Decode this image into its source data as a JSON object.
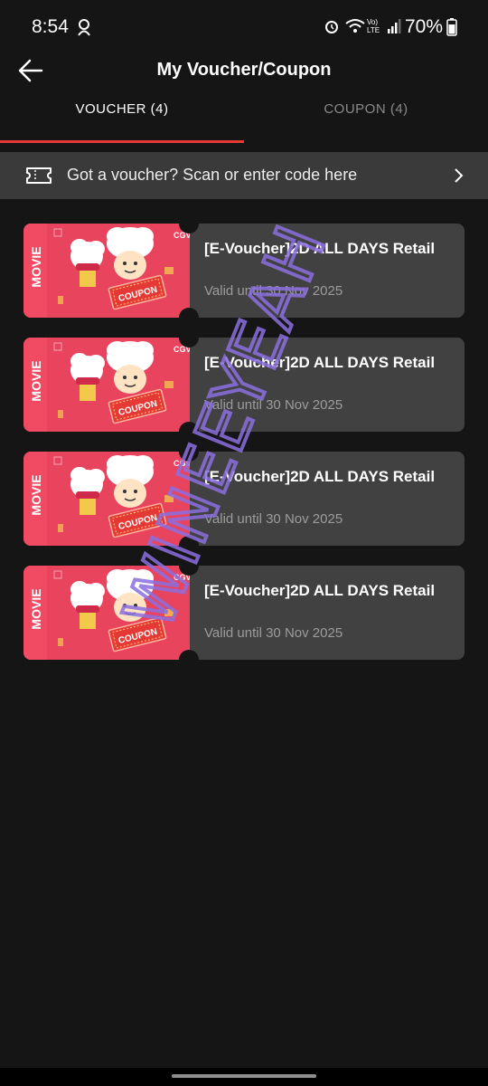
{
  "status": {
    "time": "8:54",
    "battery": "70%",
    "signal_label": "Vo) LTE"
  },
  "header": {
    "title": "My Voucher/Coupon"
  },
  "tabs": [
    {
      "label": "VOUCHER (4)",
      "active": true
    },
    {
      "label": "COUPON (4)",
      "active": false
    }
  ],
  "scan": {
    "text": "Got a voucher? Scan or enter code here"
  },
  "vouchers": [
    {
      "category": "MOVIE",
      "brand": "CGV",
      "badge": "COUPON",
      "title": "[E-Voucher]2D ALL DAYS Retail",
      "valid": "Valid until 30 Nov 2025"
    },
    {
      "category": "MOVIE",
      "brand": "CGV",
      "badge": "COUPON",
      "title": "[E-Voucher]2D ALL DAYS Retail",
      "valid": "Valid until 30 Nov 2025"
    },
    {
      "category": "MOVIE",
      "brand": "CGV",
      "badge": "COUPON",
      "title": "[E-Voucher]2D ALL DAYS Retail",
      "valid": "Valid until 30 Nov 2025"
    },
    {
      "category": "MOVIE",
      "brand": "CGV",
      "badge": "COUPON",
      "title": "[E-Voucher]2D ALL DAYS Retail",
      "valid": "Valid until 30 Nov 2025"
    }
  ],
  "watermark": {
    "text": "WINEEYEAH"
  },
  "colors": {
    "accent": "#e53935",
    "background": "#151515",
    "card": "#414141",
    "voucher_red": "#ea3a55",
    "watermark": "#8b6fe0"
  },
  "icons": {
    "back": "arrow-left-icon",
    "scan": "ticket-icon",
    "chevron": "chevron-right-icon"
  }
}
